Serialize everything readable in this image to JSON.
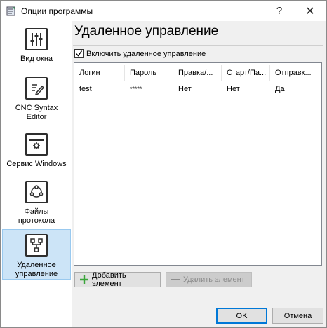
{
  "window": {
    "title": "Опции программы",
    "help": "?",
    "close": "✕"
  },
  "sidebar": {
    "items": [
      {
        "label": "Вид окна",
        "icon": "sliders-icon"
      },
      {
        "label": "CNC Syntax Editor",
        "icon": "edit-document-icon"
      },
      {
        "label": "Сервис Windows",
        "icon": "service-window-icon"
      },
      {
        "label": "Файлы протокола",
        "icon": "log-files-icon"
      },
      {
        "label": "Удаленное управление",
        "icon": "remote-control-icon",
        "selected": true
      }
    ]
  },
  "main": {
    "title": "Удаленное управление",
    "enable_label": "Включить удаленное управление",
    "enable_checked": true,
    "columns": [
      "Логин",
      "Пароль",
      "Правка/...",
      "Старт/Па...",
      "Отправк..."
    ],
    "rows": [
      [
        "test",
        "*****",
        "Нет",
        "Нет",
        "Да"
      ]
    ],
    "add_button": "Добавить элемент",
    "delete_button": "Удалить элемент"
  },
  "footer": {
    "ok": "OK",
    "cancel": "Отмена"
  },
  "colors": {
    "selected_bg": "#cce4f7",
    "selected_border": "#99c9ef",
    "accent": "#0078d7",
    "add_green": "#3aa53a"
  }
}
